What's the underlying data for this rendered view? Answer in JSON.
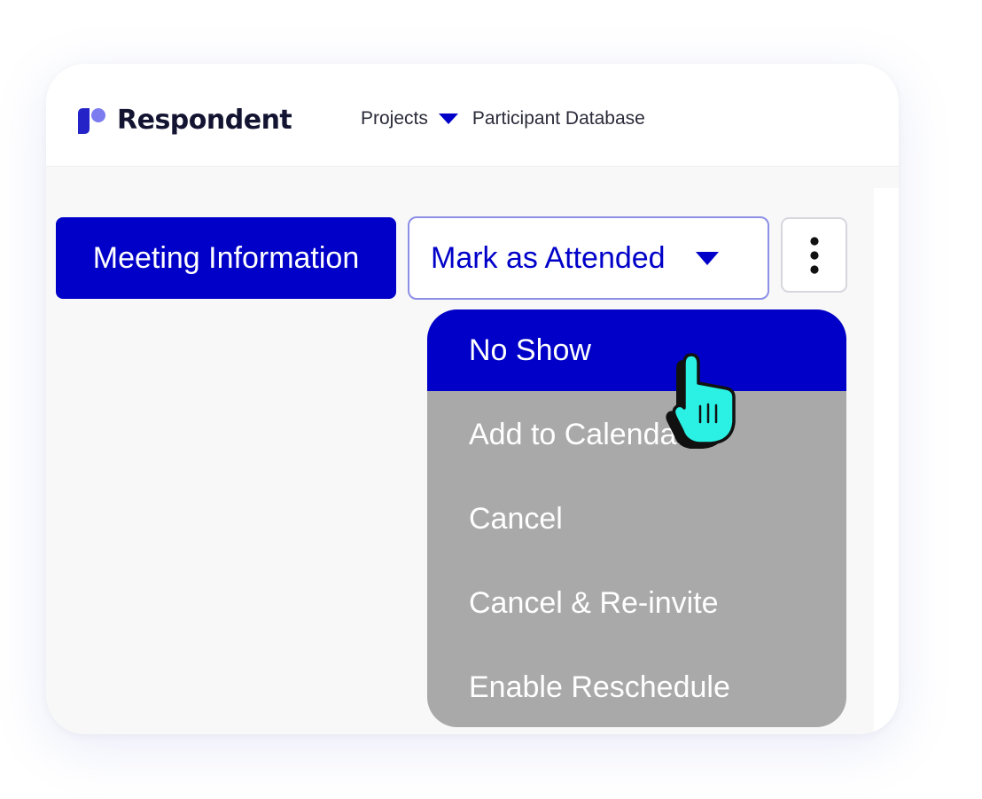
{
  "brand": {
    "name": "Respondent",
    "logo_icon": "respondent-logo-mark",
    "colors": {
      "primary": "#0000c8",
      "logo_blue": "#2323c8",
      "logo_light": "#7c7cf0",
      "menu_gray": "#a9a9a9",
      "cursor": "#2af1e4"
    }
  },
  "nav": {
    "items": [
      {
        "label": "Projects",
        "has_dropdown": true
      },
      {
        "label": "Participant Database",
        "has_dropdown": false
      }
    ]
  },
  "toolbar": {
    "meeting_info_label": "Meeting Information",
    "status_select_label": "Mark as Attended",
    "more_icon": "kebab-menu-icon"
  },
  "dropdown": {
    "items": [
      {
        "label": "No Show",
        "active": true
      },
      {
        "label": "Add to Calendar",
        "active": false
      },
      {
        "label": "Cancel",
        "active": false
      },
      {
        "label": "Cancel & Re-invite",
        "active": false
      },
      {
        "label": "Enable Reschedule",
        "active": false
      }
    ]
  },
  "pointer": {
    "icon": "hand-pointer-icon"
  }
}
